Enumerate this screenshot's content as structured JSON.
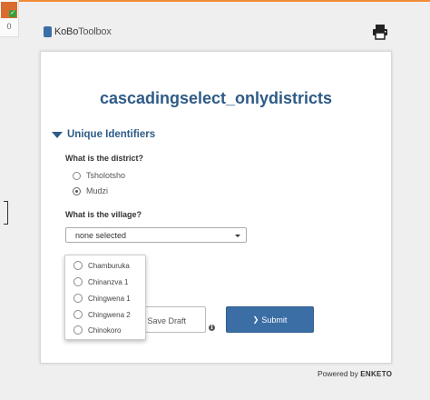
{
  "queue": {
    "count": "0"
  },
  "header": {
    "logo_bold": "KoBo",
    "logo_light": "Toolbox"
  },
  "form": {
    "title": "cascadingselect_onlydistricts",
    "group_title": "Unique Identifiers",
    "district_question": "What is the district?",
    "district_options": [
      "Tsholotsho",
      "Mudzi"
    ],
    "village_question": "What is the village?",
    "village_select_value": "none selected",
    "village_options": [
      "Chamburuka",
      "Chinanzva 1",
      "Chingwena 1",
      "Chingwena 2",
      "Chinokoro"
    ]
  },
  "actions": {
    "save_draft": "Save Draft",
    "submit": "Submit"
  },
  "footer": {
    "powered_by": "Powered by",
    "brand": "ENKETO"
  },
  "colors": {
    "accent": "#3a6ea5",
    "title": "#2e5b87",
    "topline": "#f28c38"
  }
}
